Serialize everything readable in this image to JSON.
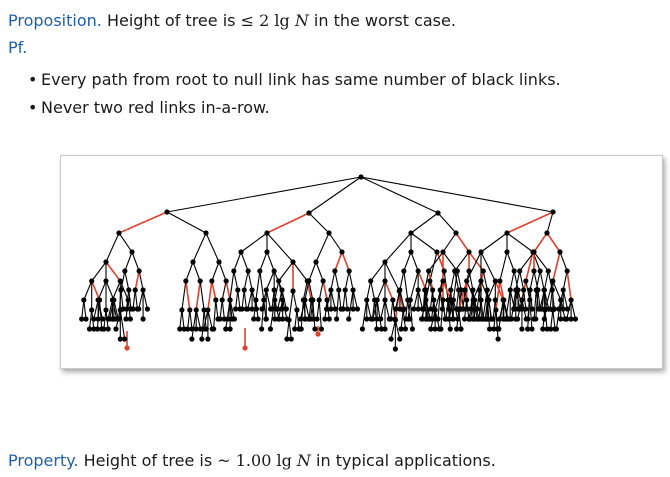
{
  "proposition": {
    "label": "Proposition.",
    "text_before": "Height of tree is",
    "bound_symbol": "≤",
    "bound_coefficient": "2",
    "log": "lg",
    "variable": "N",
    "text_after": "in the worst case."
  },
  "proof": {
    "label": "Pf.",
    "bullets": [
      "Every path from root to null link has same number of black links.",
      "Never two red links in-a-row."
    ]
  },
  "property": {
    "label": "Property.",
    "text_before": "Height of tree is",
    "bound_symbol": "~",
    "bound_coefficient": "1.00",
    "log": "lg",
    "variable": "N",
    "text_after": "in typical applications."
  },
  "tree": {
    "link_colors": {
      "black": "#000000",
      "red": "#e0412c"
    },
    "node_color": "#000000",
    "red_node_color": "#e0412c"
  },
  "colors": {
    "keyword": "#1f5fa8",
    "text": "#1a1a1a"
  }
}
